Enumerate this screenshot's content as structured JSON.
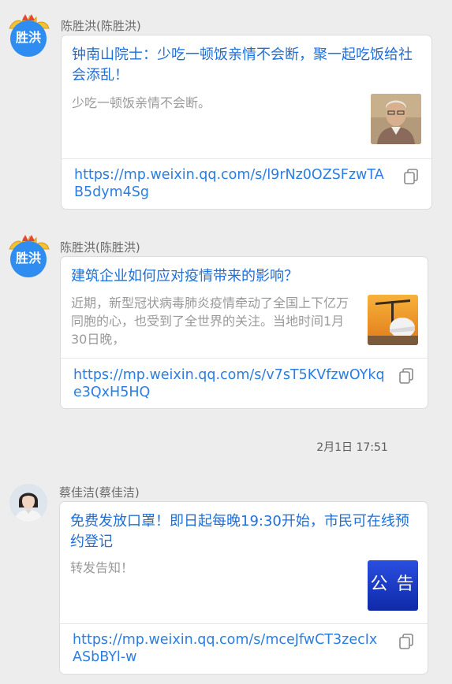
{
  "messages": [
    {
      "sender": "陈胜洪(陈胜洪)",
      "avatar_text": "胜洪",
      "title": "钟南山院士：少吃一顿饭亲情不会断，聚一起吃饭给社会添乱！",
      "description": "少吃一顿饭亲情不会断。",
      "link": "https://mp.weixin.qq.com/s/l9rNz0OZSFzwTAB5dym4Sg"
    },
    {
      "sender": "陈胜洪(陈胜洪)",
      "avatar_text": "胜洪",
      "title": "建筑企业如何应对疫情带来的影响？",
      "description": "近期，新型冠状病毒肺炎疫情牵动了全国上下亿万同胞的心，也受到了全世界的关注。当地时间1月30日晚，",
      "link": "https://mp.weixin.qq.com/s/v7sT5KVfzwOYkqe3QxH5HQ"
    },
    {
      "sender": "蔡佳洁(蔡佳洁)",
      "title": "免费发放口罩！即日起每晚19:30开始，市民可在线预约登记",
      "description": "转发告知！",
      "thumb_text": "公 告",
      "link": "https://mp.weixin.qq.com/s/mceJfwCT3zecIxASbBYl-w"
    }
  ],
  "timestamp": "2月1日 17:51",
  "colors": {
    "background": "#ededed",
    "link": "#2b7de0",
    "title": "#1e6fd9",
    "avatar_blue": "#2f8cf0",
    "notice_blue": "#1a3bd6"
  }
}
